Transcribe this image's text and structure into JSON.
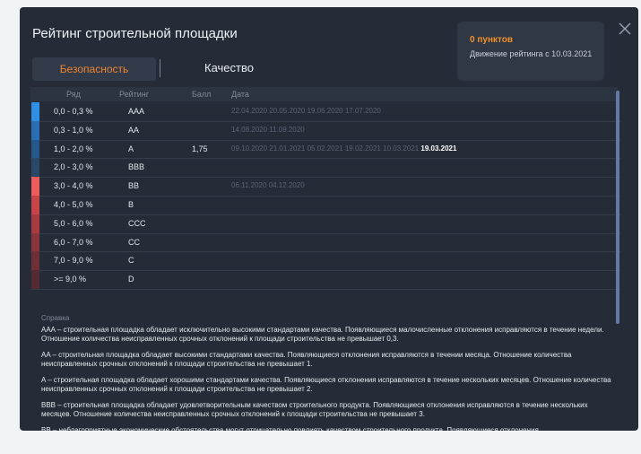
{
  "modal": {
    "title": "Рейтинг строительной площадки"
  },
  "points": {
    "title": "0 пунктов",
    "subtitle": "Движение рейтинга с 10.03.2021"
  },
  "tabs": {
    "safety": "Безопасность",
    "quality": "Качество",
    "active": "safety"
  },
  "table": {
    "headers": {
      "range": "Ряд",
      "rating": "Рейтинг",
      "score": "Балл",
      "date": "Дата"
    },
    "rows": [
      {
        "range": "0,0 - 0,3 %",
        "rating": "AAA",
        "score": "",
        "color": "#2f8ee6",
        "dates": [
          "22.04.2020",
          "20.05.2020",
          "19.06.2020",
          "17.07.2020"
        ],
        "highlight": ""
      },
      {
        "range": "0,3 - 1,0 %",
        "rating": "AA",
        "score": "",
        "color": "#2a6fb3",
        "dates": [
          "14.08.2020",
          "11.09.2020"
        ],
        "highlight": ""
      },
      {
        "range": "1,0 - 2,0 %",
        "rating": "A",
        "score": "1,75",
        "color": "#24578a",
        "dates": [
          "09.10.2020",
          "21.01.2021",
          "05.02.2021",
          "19.02.2021",
          "10.03.2021"
        ],
        "highlight": "19.03.2021"
      },
      {
        "range": "2,0 - 3,0 %",
        "rating": "BBB",
        "score": "",
        "color": "#2b4868",
        "dates": [],
        "highlight": ""
      },
      {
        "range": "3,0 - 4,0 %",
        "rating": "BB",
        "score": "",
        "color": "#ef5c5c",
        "dates": [
          "06.11.2020",
          "04.12.2020"
        ],
        "highlight": ""
      },
      {
        "range": "4,0 - 5,0 %",
        "rating": "B",
        "score": "",
        "color": "#c94446",
        "dates": [],
        "highlight": ""
      },
      {
        "range": "5,0 - 6,0 %",
        "rating": "CCC",
        "score": "",
        "color": "#a83a40",
        "dates": [],
        "highlight": ""
      },
      {
        "range": "6,0 - 7,0 %",
        "rating": "CC",
        "score": "",
        "color": "#8a343b",
        "dates": [],
        "highlight": ""
      },
      {
        "range": "7,0 - 9,0 %",
        "rating": "C",
        "score": "",
        "color": "#6e2f37",
        "dates": [],
        "highlight": ""
      },
      {
        "range": ">= 9,0 %",
        "rating": "D",
        "score": "",
        "color": "#552b33",
        "dates": [],
        "highlight": ""
      }
    ]
  },
  "reference": {
    "title": "Справка",
    "paragraphs": [
      "AAA – строительная площадка обладает исключительно высокими стандартами качества. Появляющиеся  малочисленные отклонения исправляются в течение недели. Отношение количества неисправленных срочных отклонений к площади строительства не превышает 0,3.",
      "AA – строительная площадка обладает высокими стандартами качества. Появляющиеся  отклонения исправляются в течении месяца. Отношение количества неисправленных срочных отклонений к площади строительства не превышает 1.",
      "A – строительная площадка обладает хорошими стандартами качества. Появляющиеся  отклонения исправляются в течение нескольких месяцев. Отношение количества неисправленных срочных отклонений к площади строительства не превышает 2.",
      "BBB – строительная площадка обладает удовлетворительным  качеством строительного продукта. Появляющиеся  отклонения исправляются в течение нескольких месяцев. Отношение количества неисправленных срочных отклонений к площади строительства не превышает 3.",
      "BB – неблагоприятные экономические обстоятельства могут отрицательно повлиять качеством строительного продукта. Появляющиеся  отклонения"
    ]
  }
}
